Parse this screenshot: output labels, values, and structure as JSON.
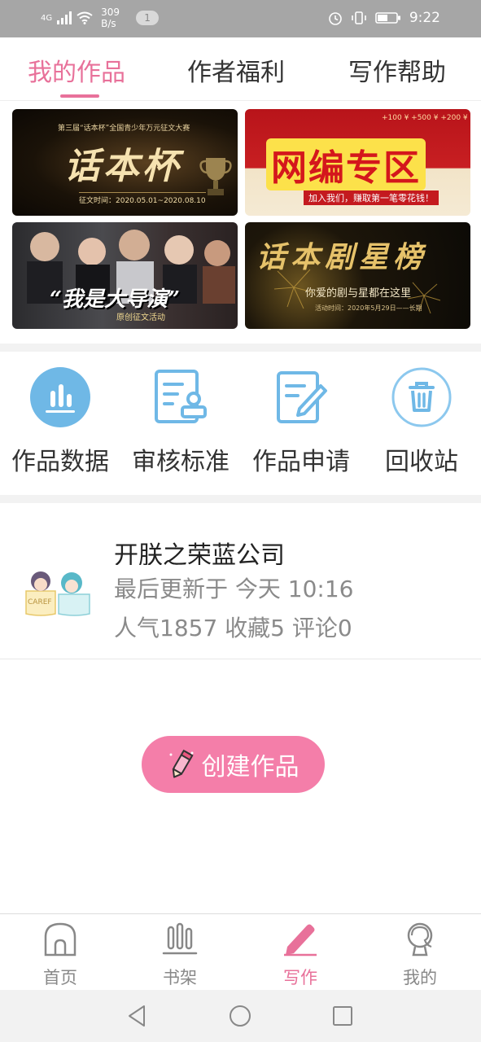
{
  "status_bar": {
    "network": "4G",
    "speed_value": "309",
    "speed_unit": "B/s",
    "notification_count": "1",
    "time": "9:22"
  },
  "tabs": [
    {
      "label": "我的作品",
      "active": true
    },
    {
      "label": "作者福利",
      "active": false
    },
    {
      "label": "写作帮助",
      "active": false
    }
  ],
  "banners": [
    {
      "title": "话本杯",
      "subtitle": "第三届“话本杯”全国青少年万元征文大赛",
      "note": "征文时间：2020.05.01~2020.08.10"
    },
    {
      "title": "网编专区",
      "subtitle": "加入我们，赚取第一笔零花钱！",
      "note": "+100 ¥  +500 ¥  +200 ¥"
    },
    {
      "title": "“我是大导演”",
      "subtitle": "原创征文活动",
      "note": ""
    },
    {
      "title": "话本剧星榜",
      "subtitle": "你爱的剧与星都在这里",
      "note": "活动时间：2020年5月29日——长期"
    }
  ],
  "quick_menu": [
    {
      "label": "作品数据",
      "icon": "bar-chart-icon"
    },
    {
      "label": "审核标准",
      "icon": "document-stamp-icon"
    },
    {
      "label": "作品申请",
      "icon": "edit-document-icon"
    },
    {
      "label": "回收站",
      "icon": "trash-icon"
    }
  ],
  "work": {
    "title": "开朕之荣蓝公司",
    "updated": "最后更新于 今天 10:16",
    "stats": "人气1857 收藏5 评论0",
    "cover_text": "CAREF"
  },
  "create_button": {
    "label": "创建作品"
  },
  "bottom_nav": [
    {
      "label": "首页",
      "icon": "home-icon",
      "active": false
    },
    {
      "label": "书架",
      "icon": "bookshelf-icon",
      "active": false
    },
    {
      "label": "写作",
      "icon": "pen-icon",
      "active": true
    },
    {
      "label": "我的",
      "icon": "profile-icon",
      "active": false
    }
  ],
  "colors": {
    "accent": "#e8719a",
    "icon_blue": "#6fb8e6",
    "status_bar": "#a6a6a6"
  }
}
